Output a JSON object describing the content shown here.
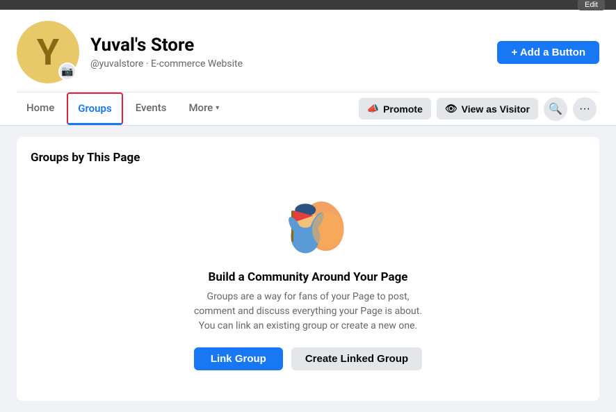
{
  "topbar": {
    "edit_label": "Edit"
  },
  "profile": {
    "avatar_letter": "Y",
    "name": "Yuval's Store",
    "handle": "@yuvalstore",
    "type": "E-commerce Website",
    "add_button_label": "+ Add a Button",
    "camera_icon": "📷"
  },
  "nav": {
    "tabs": [
      {
        "id": "home",
        "label": "Home",
        "active": false
      },
      {
        "id": "groups",
        "label": "Groups",
        "active": true
      },
      {
        "id": "events",
        "label": "Events",
        "active": false
      },
      {
        "id": "more",
        "label": "More",
        "active": false
      }
    ],
    "promote_label": "Promote",
    "view_as_label": "View as Visitor",
    "search_icon": "🔍",
    "more_icon": "···"
  },
  "groups": {
    "section_title": "Groups by This Page",
    "empty_title": "Build a Community Around Your Page",
    "empty_desc": "Groups are a way for fans of your Page to post, comment and discuss everything your Page is about. You can link an existing group or create a new one.",
    "link_group_label": "Link Group",
    "create_group_label": "Create Linked Group"
  },
  "colors": {
    "blue": "#1877f2",
    "gray_bg": "#e4e6ea",
    "text_dark": "#050505",
    "text_light": "#65676b",
    "active_tab": "#1877f2",
    "active_border": "#e41e3f"
  }
}
